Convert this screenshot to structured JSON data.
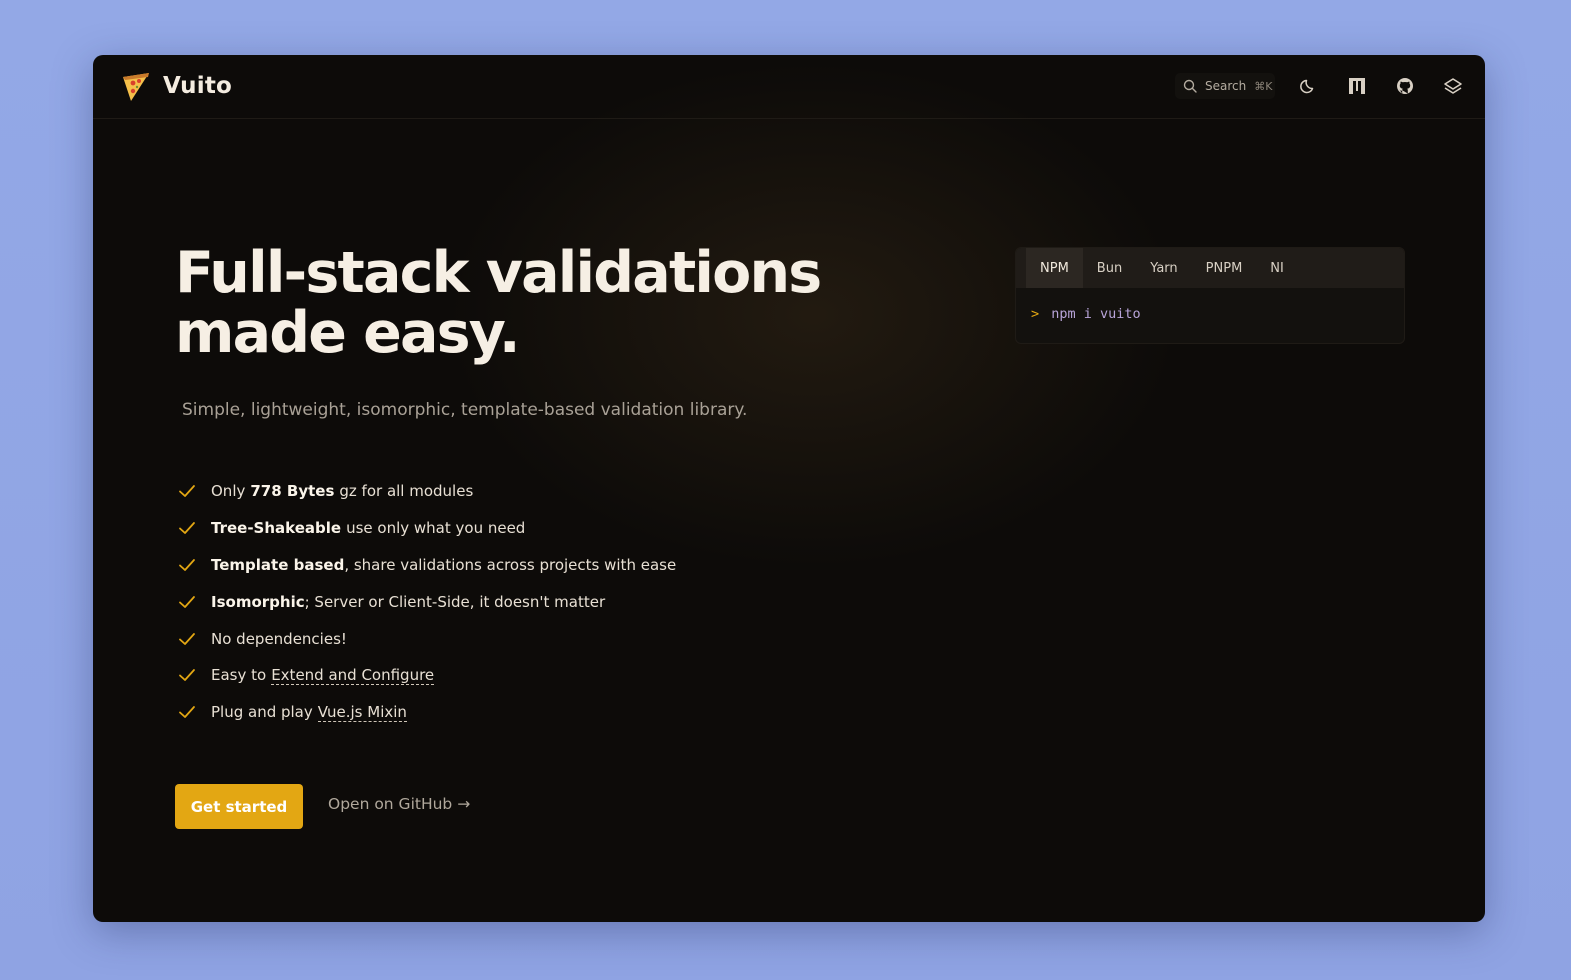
{
  "nav": {
    "brand": "Vuito",
    "search_label": "Search",
    "search_shortcut": "⌘K",
    "icons": [
      "moon-icon",
      "package-icon",
      "github-icon",
      "storybook-icon"
    ]
  },
  "hero": {
    "title": "Full-stack validations made easy.",
    "subtitle": "Simple, lightweight, isomorphic, template-based validation library.",
    "features": [
      {
        "pre": "Only",
        "bold": "778 Bytes",
        "post": "gz for all modules"
      },
      {
        "pre": "",
        "bold": "Tree-Shakeable",
        "post": "use only what you need"
      },
      {
        "pre": "",
        "bold": "Template based",
        "post": ", share validations across projects with ease"
      },
      {
        "pre": "",
        "bold": "Isomorphic",
        "post": "; Server or Client-Side, it doesn't matter"
      },
      {
        "pre": "No dependencies!",
        "bold": "",
        "post": ""
      },
      {
        "pre": "Easy to",
        "link": "Extend and Configure"
      },
      {
        "pre": "Plug and play",
        "link": "Vue.js Mixin"
      }
    ],
    "primary_button": "Get started",
    "secondary_link": "Open on GitHub →"
  },
  "install": {
    "tabs": [
      "NPM",
      "Bun",
      "Yarn",
      "PNPM",
      "NI"
    ],
    "active_tab": "NPM",
    "prompt": ">",
    "command": "npm i vuito"
  },
  "colors": {
    "accent": "#e3a713",
    "background": "#0d0b09",
    "page_background": "#93a8e6",
    "command_text": "#b8a4d9"
  }
}
